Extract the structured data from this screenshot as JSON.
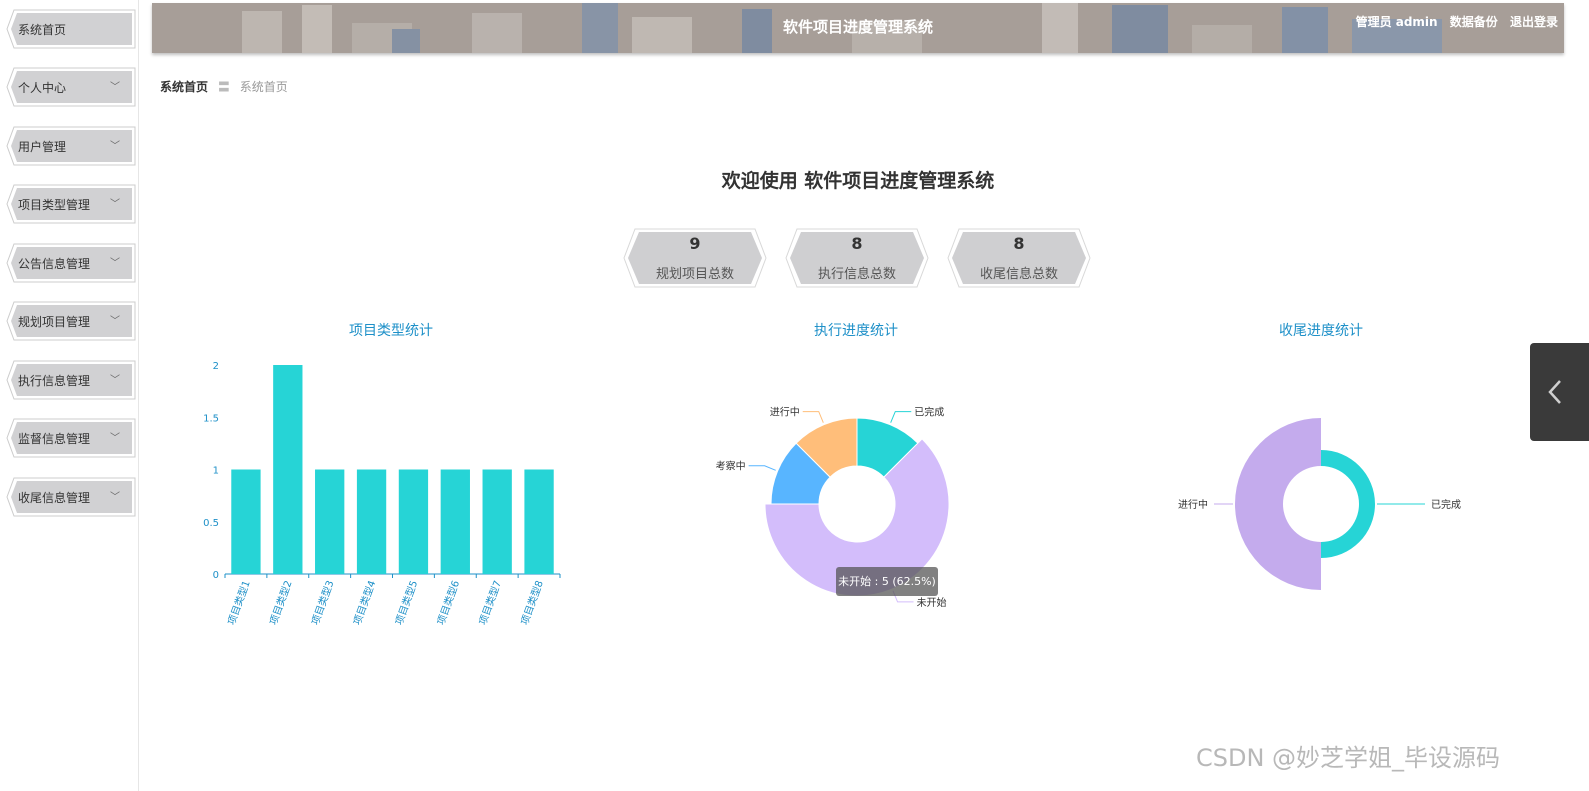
{
  "header": {
    "title": "软件项目进度管理系统",
    "user_label": "管理员 admin",
    "backup_label": "数据备份",
    "logout_label": "退出登录"
  },
  "sidebar": {
    "items": [
      {
        "label": "系统首页",
        "has_children": false
      },
      {
        "label": "个人中心",
        "has_children": true
      },
      {
        "label": "用户管理",
        "has_children": true
      },
      {
        "label": "项目类型管理",
        "has_children": true
      },
      {
        "label": "公告信息管理",
        "has_children": true
      },
      {
        "label": "规划项目管理",
        "has_children": true
      },
      {
        "label": "执行信息管理",
        "has_children": true
      },
      {
        "label": "监督信息管理",
        "has_children": true
      },
      {
        "label": "收尾信息管理",
        "has_children": true
      }
    ]
  },
  "breadcrumb": {
    "home": "系统首页",
    "separator": "〓",
    "current": "系统首页"
  },
  "welcome": "欢迎使用 软件项目进度管理系统",
  "stats": [
    {
      "value": "9",
      "label": "规划项目总数"
    },
    {
      "value": "8",
      "label": "执行信息总数"
    },
    {
      "value": "8",
      "label": "收尾信息总数"
    }
  ],
  "colors": {
    "accent": "#1e90c8",
    "bar": "#26d4d6",
    "done": "#26d4d6",
    "ongoing": "#ffbe7a",
    "review": "#58b5ff",
    "notstarted": "#d3bdfb",
    "closing_ongoing": "#c4abed"
  },
  "chart_data": [
    {
      "type": "bar",
      "title": "项目类型统计",
      "categories": [
        "项目类型1",
        "项目类型2",
        "项目类型3",
        "项目类型4",
        "项目类型5",
        "项目类型6",
        "项目类型7",
        "项目类型8"
      ],
      "values": [
        1,
        2,
        1,
        1,
        1,
        1,
        1,
        1
      ],
      "ylim": [
        0,
        2
      ],
      "yticks": [
        "0",
        "0.5",
        "1",
        "1.5",
        "2"
      ]
    },
    {
      "type": "pie",
      "title": "执行进度统计",
      "slices": [
        {
          "name": "已完成",
          "value": 1
        },
        {
          "name": "未开始",
          "value": 5
        },
        {
          "name": "考察中",
          "value": 1
        },
        {
          "name": "进行中",
          "value": 1
        }
      ],
      "tooltip": "未开始 : 5 (62.5%)"
    },
    {
      "type": "pie",
      "title": "收尾进度统计",
      "slices": [
        {
          "name": "已完成",
          "value": 1
        },
        {
          "name": "进行中",
          "value": 1
        }
      ]
    }
  ],
  "watermark": "CSDN @妙芝学姐_毕设源码",
  "icons": {
    "chevron": "chevron-down-icon",
    "handle": "chevron-left-icon"
  }
}
